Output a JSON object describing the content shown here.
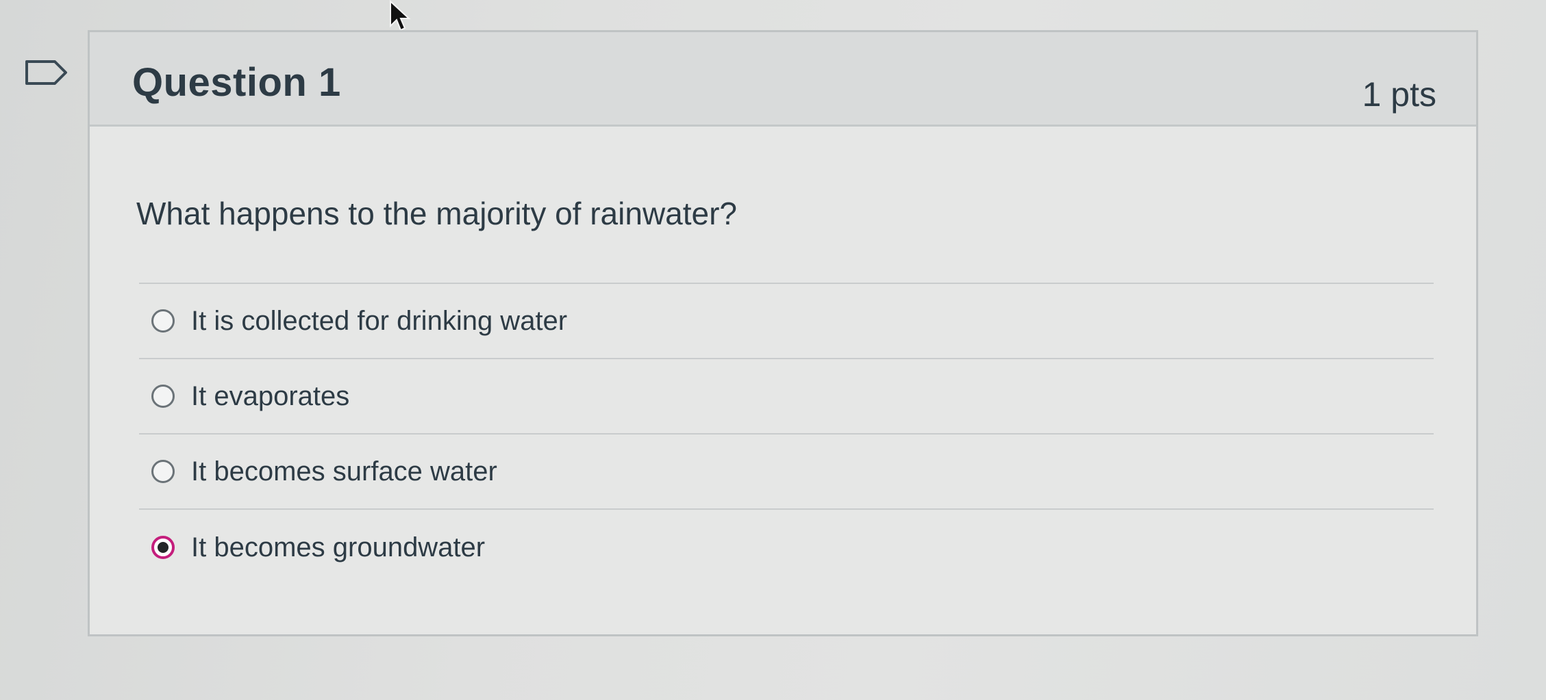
{
  "question": {
    "title": "Question 1",
    "points": "1 pts",
    "text": "What happens to the majority of rainwater?",
    "flag_icon": "flag-outline-icon"
  },
  "answers": [
    {
      "label": "It is collected for drinking water",
      "selected": false
    },
    {
      "label": "It evaporates",
      "selected": false
    },
    {
      "label": "It becomes surface water",
      "selected": false
    },
    {
      "label": "It becomes groundwater",
      "selected": true
    }
  ],
  "colors": {
    "accent": "#c41e7c",
    "text": "#2d3b45",
    "header_bg": "#d9dbdb",
    "card_bg": "#e6e7e6"
  }
}
